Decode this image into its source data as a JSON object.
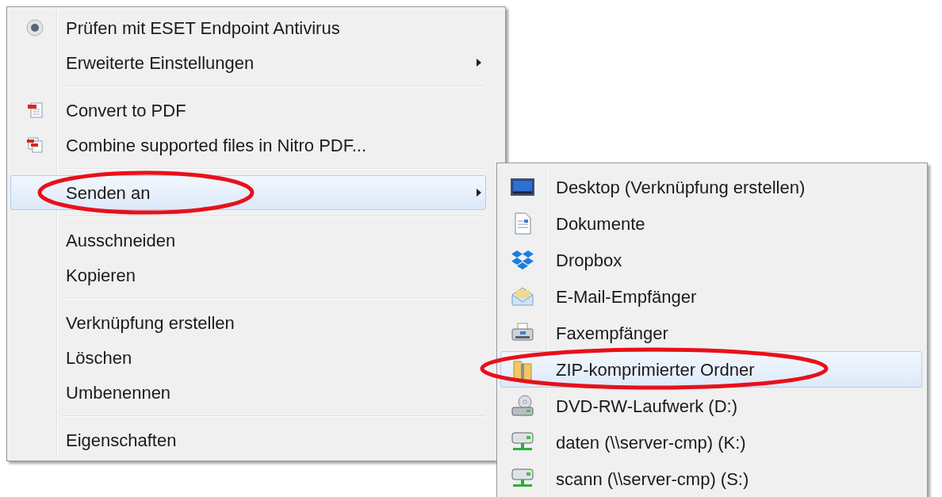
{
  "context_menu": {
    "items": [
      {
        "kind": "item",
        "label": "Prüfen mit ESET Endpoint Antivirus",
        "selected": false
      },
      {
        "kind": "submenu",
        "label": "Erweiterte Einstellungen",
        "selected": false
      },
      {
        "kind": "separator"
      },
      {
        "kind": "item",
        "label": "Convert to PDF",
        "selected": false
      },
      {
        "kind": "item",
        "label": "Combine supported files in Nitro PDF...",
        "selected": false
      },
      {
        "kind": "separator"
      },
      {
        "kind": "submenu",
        "label": "Senden an",
        "selected": true
      },
      {
        "kind": "separator"
      },
      {
        "kind": "item",
        "label": "Ausschneiden",
        "selected": false
      },
      {
        "kind": "item",
        "label": "Kopieren",
        "selected": false
      },
      {
        "kind": "separator"
      },
      {
        "kind": "item",
        "label": "Verknüpfung erstellen",
        "selected": false
      },
      {
        "kind": "item",
        "label": "Löschen",
        "selected": false
      },
      {
        "kind": "item",
        "label": "Umbenennen",
        "selected": false
      },
      {
        "kind": "separator"
      },
      {
        "kind": "item",
        "label": "Eigenschaften",
        "selected": false
      }
    ]
  },
  "send_to_menu": {
    "items": [
      {
        "label": "Desktop (Verknüpfung erstellen)",
        "selected": false
      },
      {
        "label": "Dokumente",
        "selected": false
      },
      {
        "label": "Dropbox",
        "selected": false
      },
      {
        "label": "E-Mail-Empfänger",
        "selected": false
      },
      {
        "label": "Faxempfänger",
        "selected": false
      },
      {
        "label": "ZIP-komprimierter Ordner",
        "selected": true
      },
      {
        "label": "DVD-RW-Laufwerk (D:)",
        "selected": false
      },
      {
        "label": "daten (\\\\server-cmp) (K:)",
        "selected": false
      },
      {
        "label": "scann (\\\\server-cmp) (S:)",
        "selected": false
      }
    ]
  }
}
